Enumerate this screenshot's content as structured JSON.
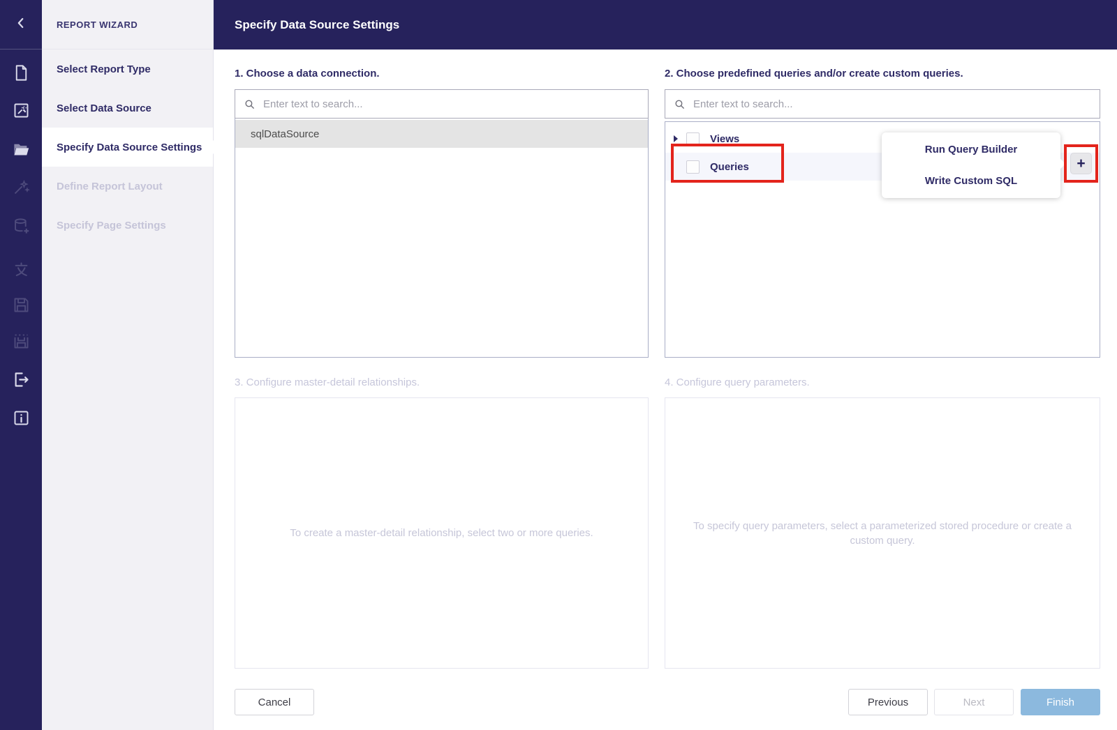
{
  "colors": {
    "accent_purple": "#26225c",
    "annotation_red": "#e3241c",
    "finish_blue": "#8cb9de",
    "selected_row_gray": "#e4e4e4"
  },
  "rail": {
    "icons": [
      {
        "name": "new-report-icon",
        "enabled": true
      },
      {
        "name": "preview-icon",
        "enabled": true
      },
      {
        "name": "open-report-icon",
        "enabled": true
      },
      {
        "name": "design-wizard-icon",
        "enabled": false
      },
      {
        "name": "add-data-source-icon",
        "enabled": false
      },
      {
        "name": "localization-icon",
        "enabled": false
      },
      {
        "name": "save-icon",
        "enabled": false
      },
      {
        "name": "save-as-icon",
        "enabled": false
      },
      {
        "name": "exit-icon",
        "enabled": true
      },
      {
        "name": "about-icon",
        "enabled": true
      }
    ]
  },
  "wizard": {
    "title": "REPORT WIZARD",
    "steps": [
      {
        "label": "Select Report Type",
        "state": "normal"
      },
      {
        "label": "Select Data Source",
        "state": "normal"
      },
      {
        "label": "Specify Data Source Settings",
        "state": "active"
      },
      {
        "label": "Define Report Layout",
        "state": "disabled"
      },
      {
        "label": "Specify Page Settings",
        "state": "disabled"
      }
    ]
  },
  "header": {
    "title": "Specify Data Source Settings"
  },
  "sections": {
    "connection": {
      "title": "1. Choose a data connection.",
      "search_placeholder": "Enter text to search...",
      "items": [
        {
          "label": "sqlDataSource",
          "selected": true
        }
      ]
    },
    "queries": {
      "title": "2. Choose predefined queries and/or create custom queries.",
      "search_placeholder": "Enter text to search...",
      "tree": [
        {
          "label": "Views",
          "expandable": true,
          "checked": false,
          "highlighted": false
        },
        {
          "label": "Queries",
          "expandable": false,
          "checked": false,
          "highlighted": true
        }
      ],
      "add_button_label": "+"
    },
    "master_detail": {
      "title": "3. Configure master-detail relationships.",
      "placeholder": "To create a master-detail relationship, select two or more queries."
    },
    "parameters": {
      "title": "4. Configure query parameters.",
      "placeholder": "To specify query parameters, select a parameterized stored procedure or create a custom query."
    }
  },
  "popup": {
    "items": [
      "Run Query Builder",
      "Write Custom SQL"
    ]
  },
  "footer": {
    "cancel": "Cancel",
    "previous": "Previous",
    "next": "Next",
    "finish": "Finish"
  }
}
